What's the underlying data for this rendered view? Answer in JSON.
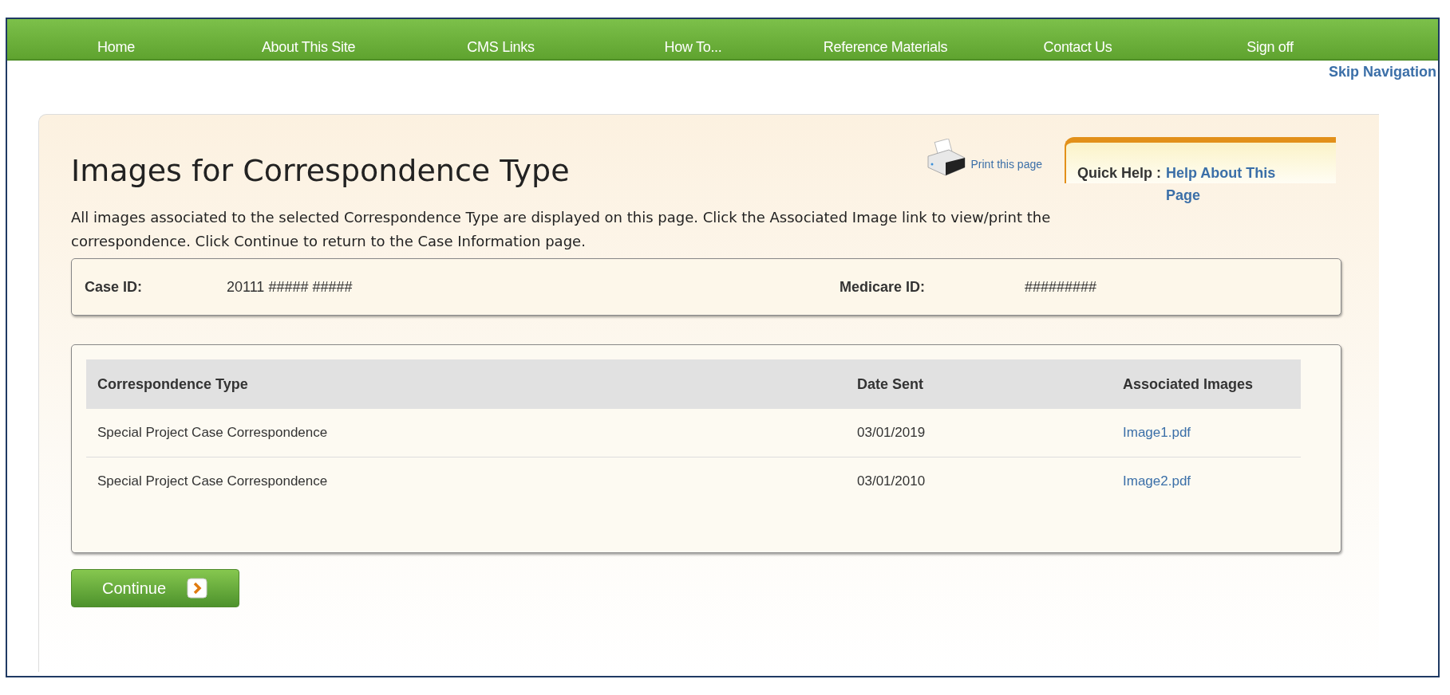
{
  "nav": {
    "items": [
      {
        "label": "Home"
      },
      {
        "label": "About This Site"
      },
      {
        "label": "CMS Links"
      },
      {
        "label": "How To..."
      },
      {
        "label": "Reference Materials"
      },
      {
        "label": "Contact Us"
      },
      {
        "label": "Sign off"
      }
    ],
    "skip_link": "Skip Navigation"
  },
  "page": {
    "title": "Images for Correspondence Type",
    "print_link": "Print this page",
    "quick_help": {
      "label": "Quick Help :",
      "link": "Help About This Page"
    },
    "description": "All images associated to the selected Correspondence Type are displayed on this page. Click the Associated Image link to view/print the correspondence. Click Continue to return to the Case Information page."
  },
  "case_info": [
    {
      "label": "Case ID:",
      "value": "20111 ##### #####"
    },
    {
      "label": "Medicare ID:",
      "value": "#########"
    }
  ],
  "table": {
    "columns": [
      "Correspondence Type",
      "Date Sent",
      "Associated Images"
    ],
    "rows": [
      {
        "type": "Special Project Case Correspondence",
        "date": "03/01/2019",
        "image": "Image1.pdf"
      },
      {
        "type": "Special Project Case Correspondence",
        "date": "03/01/2010",
        "image": "Image2.pdf"
      }
    ]
  },
  "continue_button": "Continue"
}
